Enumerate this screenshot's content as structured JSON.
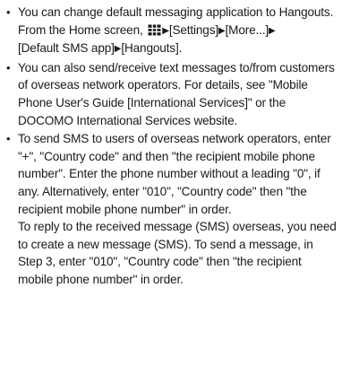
{
  "items": [
    {
      "bullet": "•",
      "text": "You can change default messaging application to Hangouts.",
      "sub": {
        "prefix": "From the Home screen, ",
        "icon": "apps-grid-icon",
        "arrow": "▶",
        "steps": [
          "[Settings]",
          "[More...]",
          "[Default SMS app]",
          "[Hangouts]"
        ]
      }
    },
    {
      "bullet": "•",
      "text": "You can also send/receive text messages to/from customers of overseas network operators. For details, see \"Mobile Phone User's Guide [International Services]\" or the DOCOMO International Services website."
    },
    {
      "bullet": "•",
      "text": "To send SMS to users of overseas network operators, enter \"+\", \"Country code\" and then \"the recipient mobile phone number\". Enter the phone number without a leading \"0\", if any. Alternatively, enter \"010\", \"Country code\" then \"the recipient mobile phone number\" in order.",
      "note": "To reply to the received message (SMS) overseas, you need to create a new message (SMS). To send a message, in Step 3, enter \"010\", \"Country code\" then \"the recipient mobile phone number\" in order."
    }
  ]
}
